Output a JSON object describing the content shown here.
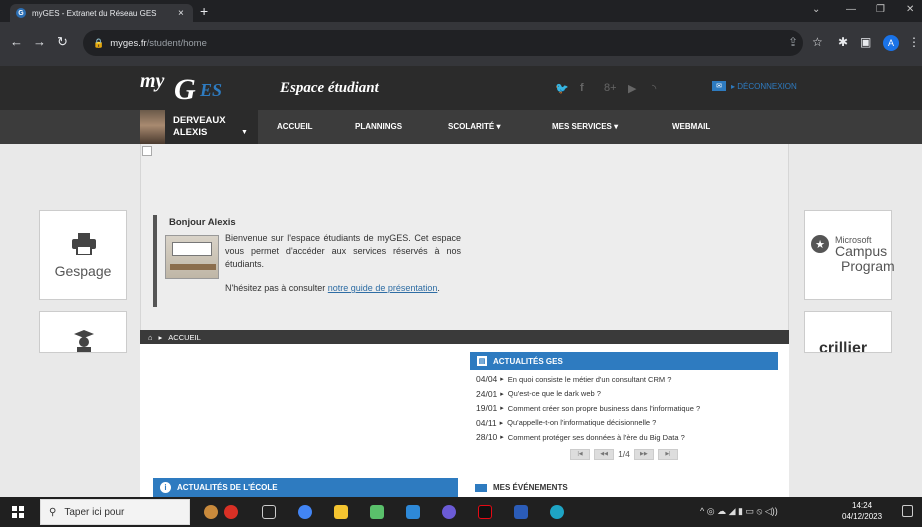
{
  "browser": {
    "tab_title": "myGES - Extranet du Réseau GES",
    "tab_close": "×",
    "new_tab": "+",
    "url_host": "myges.fr",
    "url_path": "/student/home",
    "avatar_letter": "A"
  },
  "header": {
    "logo_my": "my",
    "logo_g": "G",
    "logo_es": "ES",
    "tagline": "Espace étudiant",
    "logout_label": "▸ DÉCONNEXION",
    "social_icons": [
      "twitter-icon",
      "facebook-icon",
      "google-plus-icon",
      "youtube-icon",
      "rss-icon"
    ]
  },
  "user": {
    "last_name": "DERVEAUX",
    "first_name": "ALEXIS"
  },
  "menu": {
    "accueil": "ACCUEIL",
    "plannings": "PLANNINGS",
    "scolarite": "SCOLARITÉ ▾",
    "services": "MES SERVICES ▾",
    "webmail": "WEBMAIL"
  },
  "breadcrumb": {
    "label": "ACCUEIL"
  },
  "sidebar_left": {
    "gespage": "Gespage"
  },
  "sidebar_right": {
    "microsoft": "Microsoft",
    "campus": "Campus",
    "program": "Program",
    "crillier": "cri||ier"
  },
  "welcome": {
    "greeting": "Bonjour Alexis",
    "text": "Bienvenue sur l'espace étudiants de myGES. Cet espace vous permet d'accéder aux services réservés à nos étudiants.",
    "more_prefix": "N'hésitez pas à consulter ",
    "more_link": "notre guide de présentation",
    "more_suffix": "."
  },
  "news": {
    "title": "ACTUALITÉS GES",
    "items": [
      {
        "date": "04/04",
        "text": "En quoi consiste le métier d'un consultant CRM ?"
      },
      {
        "date": "24/01",
        "text": "Qu'est-ce que le dark web ?"
      },
      {
        "date": "19/01",
        "text": "Comment créer son propre business dans l'informatique ?"
      },
      {
        "date": "04/11",
        "text": "Qu'appelle-t-on l'informatique décisionnelle ?"
      },
      {
        "date": "28/10",
        "text": "Comment protéger ses données à l'ère du Big Data ?"
      }
    ],
    "page": "1/4"
  },
  "ecole": {
    "title": "ACTUALITÉS DE L'ÉCOLE"
  },
  "events": {
    "title": "MES ÉVÉNEMENTS"
  },
  "taskbar": {
    "search_placeholder": "Taper ici pour",
    "time": "14:24",
    "date": "04/12/2023"
  },
  "colors": {
    "accent_blue": "#2e7bc0",
    "header_dark": "#2b2b2b",
    "menu_dark": "#3c3c3c"
  }
}
